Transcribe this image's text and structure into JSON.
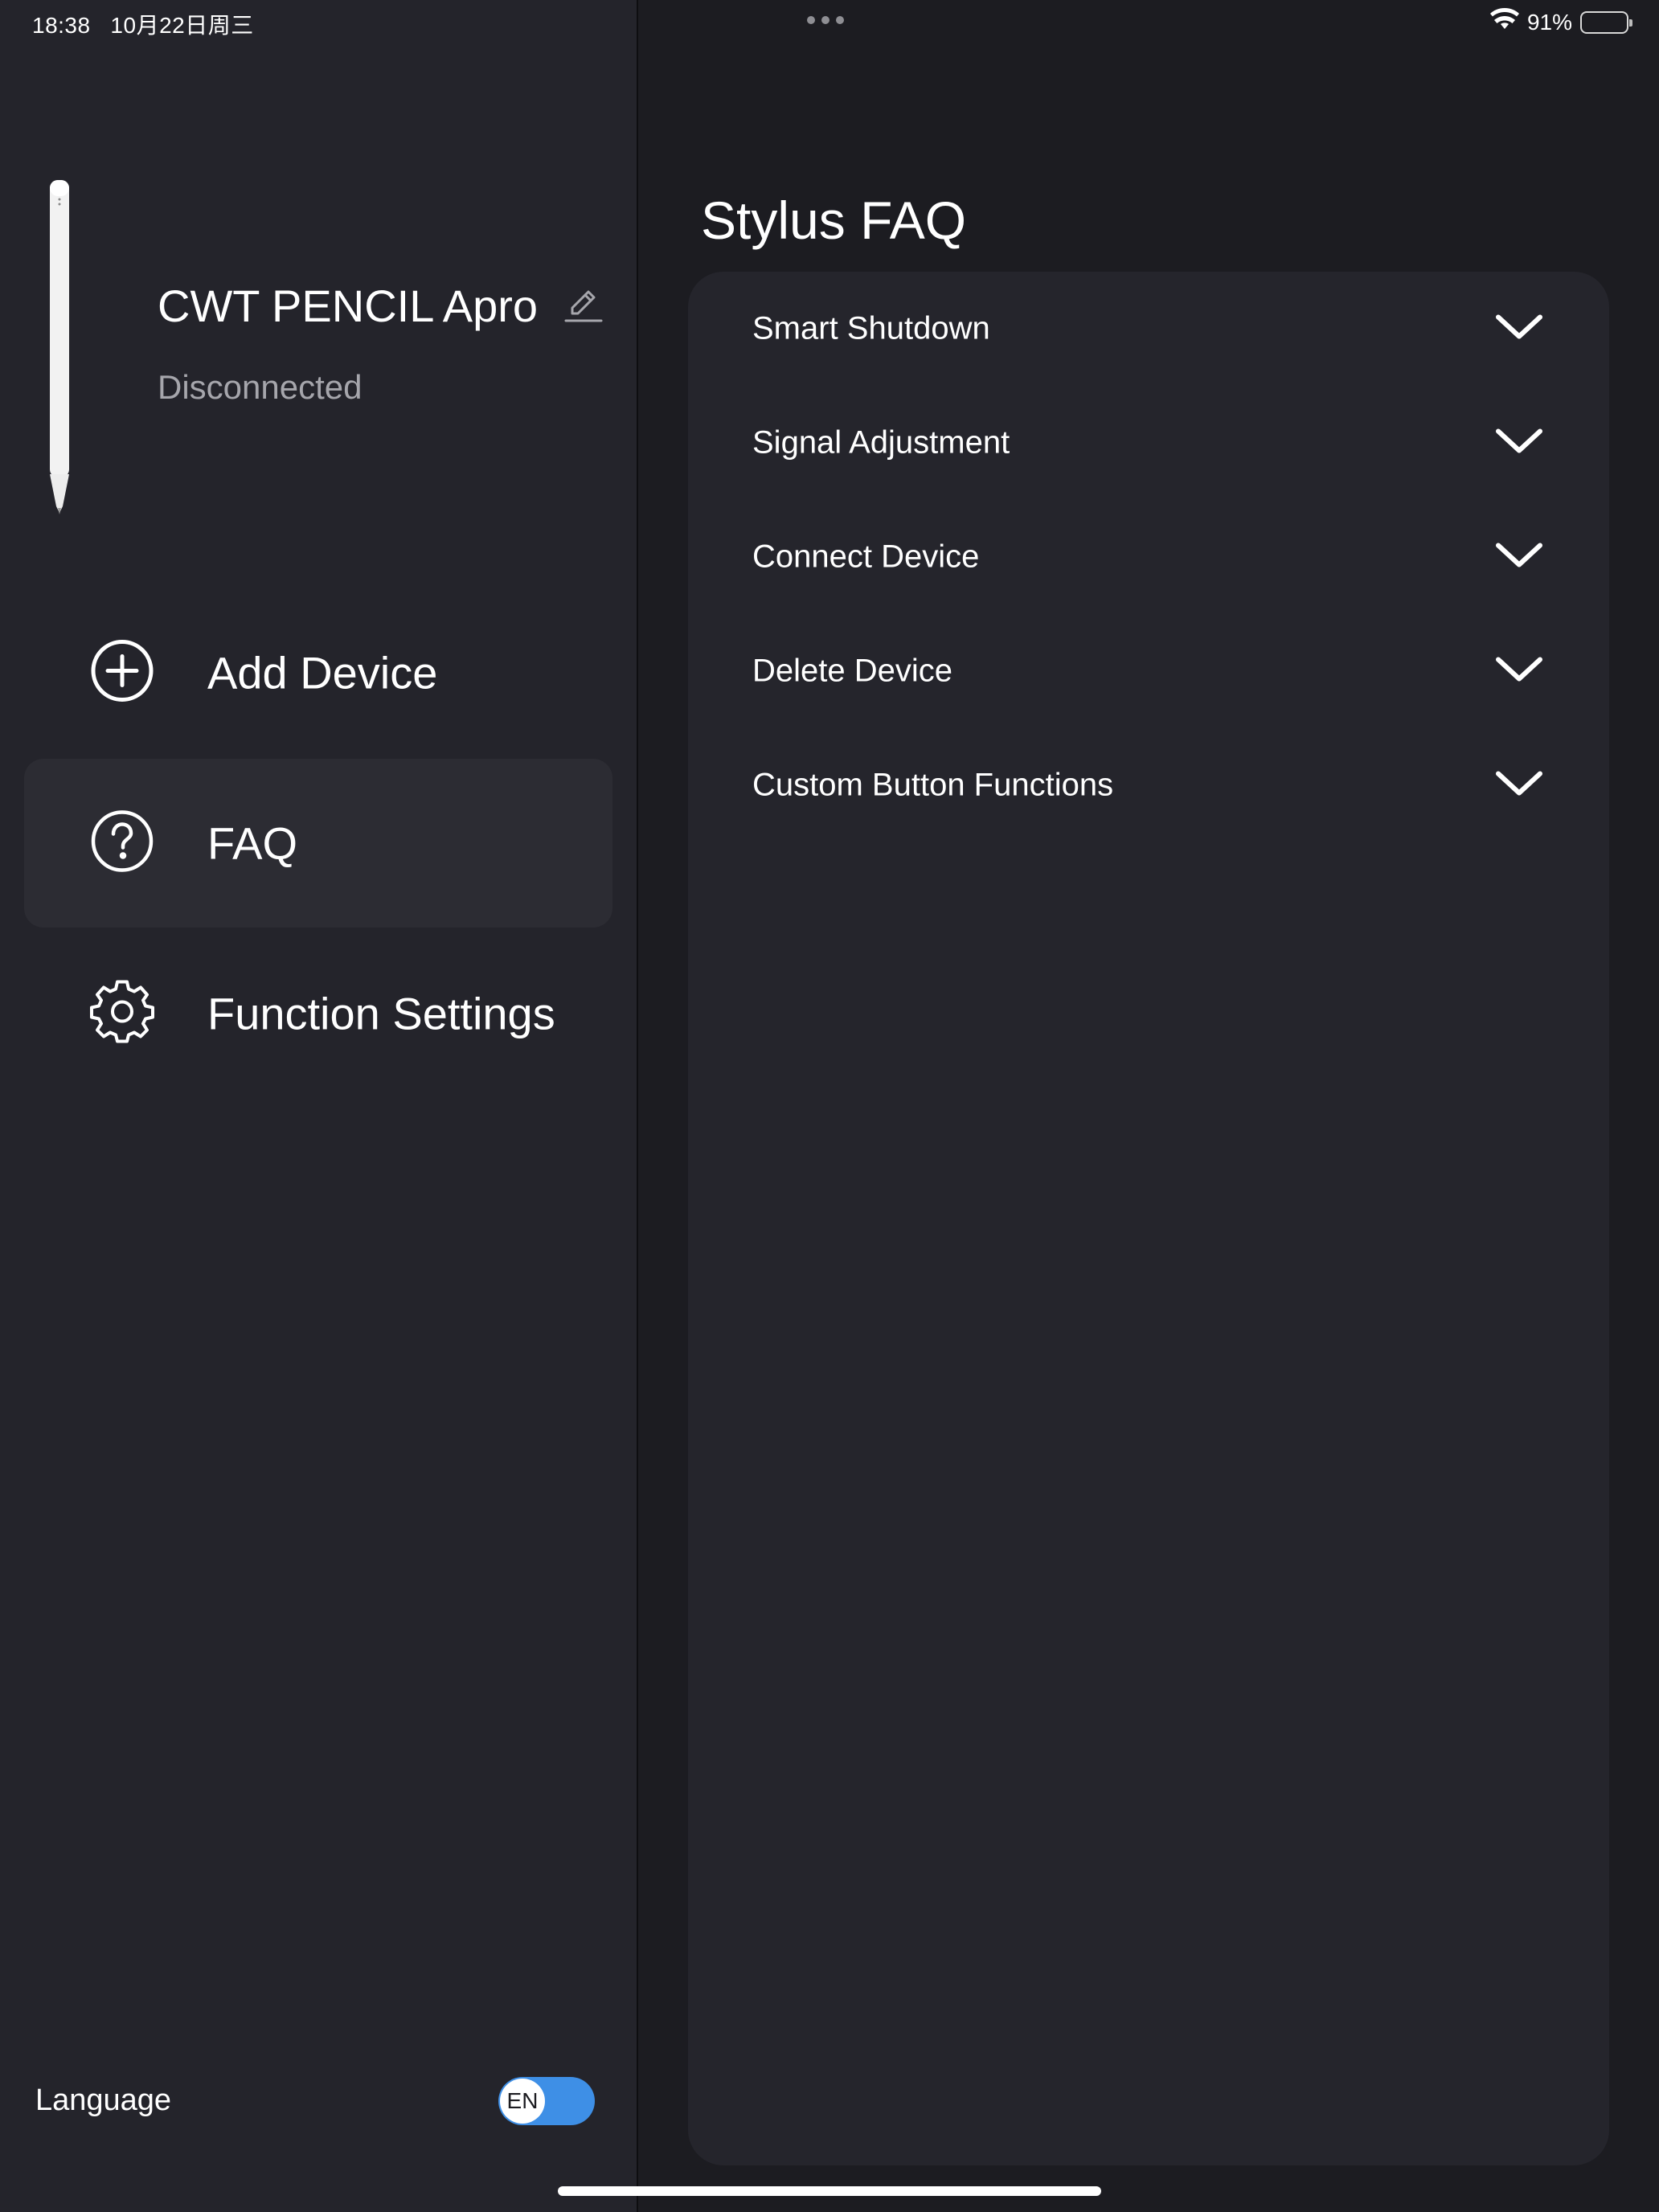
{
  "status_bar": {
    "time": "18:38",
    "date": "10月22日周三",
    "battery_percent": "91%",
    "battery_level": 0.91
  },
  "device": {
    "name": "CWT PENCIL Apro",
    "status": "Disconnected"
  },
  "nav": {
    "items": [
      {
        "label": "Add Device",
        "icon": "add-circle-icon",
        "active": false
      },
      {
        "label": "FAQ",
        "icon": "question-circle-icon",
        "active": true
      },
      {
        "label": "Function Settings",
        "icon": "gear-icon",
        "active": false
      }
    ]
  },
  "language": {
    "label": "Language",
    "value": "EN"
  },
  "main": {
    "title": "Stylus FAQ",
    "faq_items": [
      {
        "label": "Smart Shutdown"
      },
      {
        "label": "Signal Adjustment"
      },
      {
        "label": "Connect Device"
      },
      {
        "label": "Delete Device"
      },
      {
        "label": "Custom Button Functions"
      }
    ]
  },
  "colors": {
    "sidebar_bg": "#24242b",
    "main_bg": "#1c1c21",
    "card_bg": "#25252c",
    "active_nav_bg": "#2c2c33",
    "toggle_accent": "#3e8fe6",
    "muted_text": "#a6a6ac"
  }
}
